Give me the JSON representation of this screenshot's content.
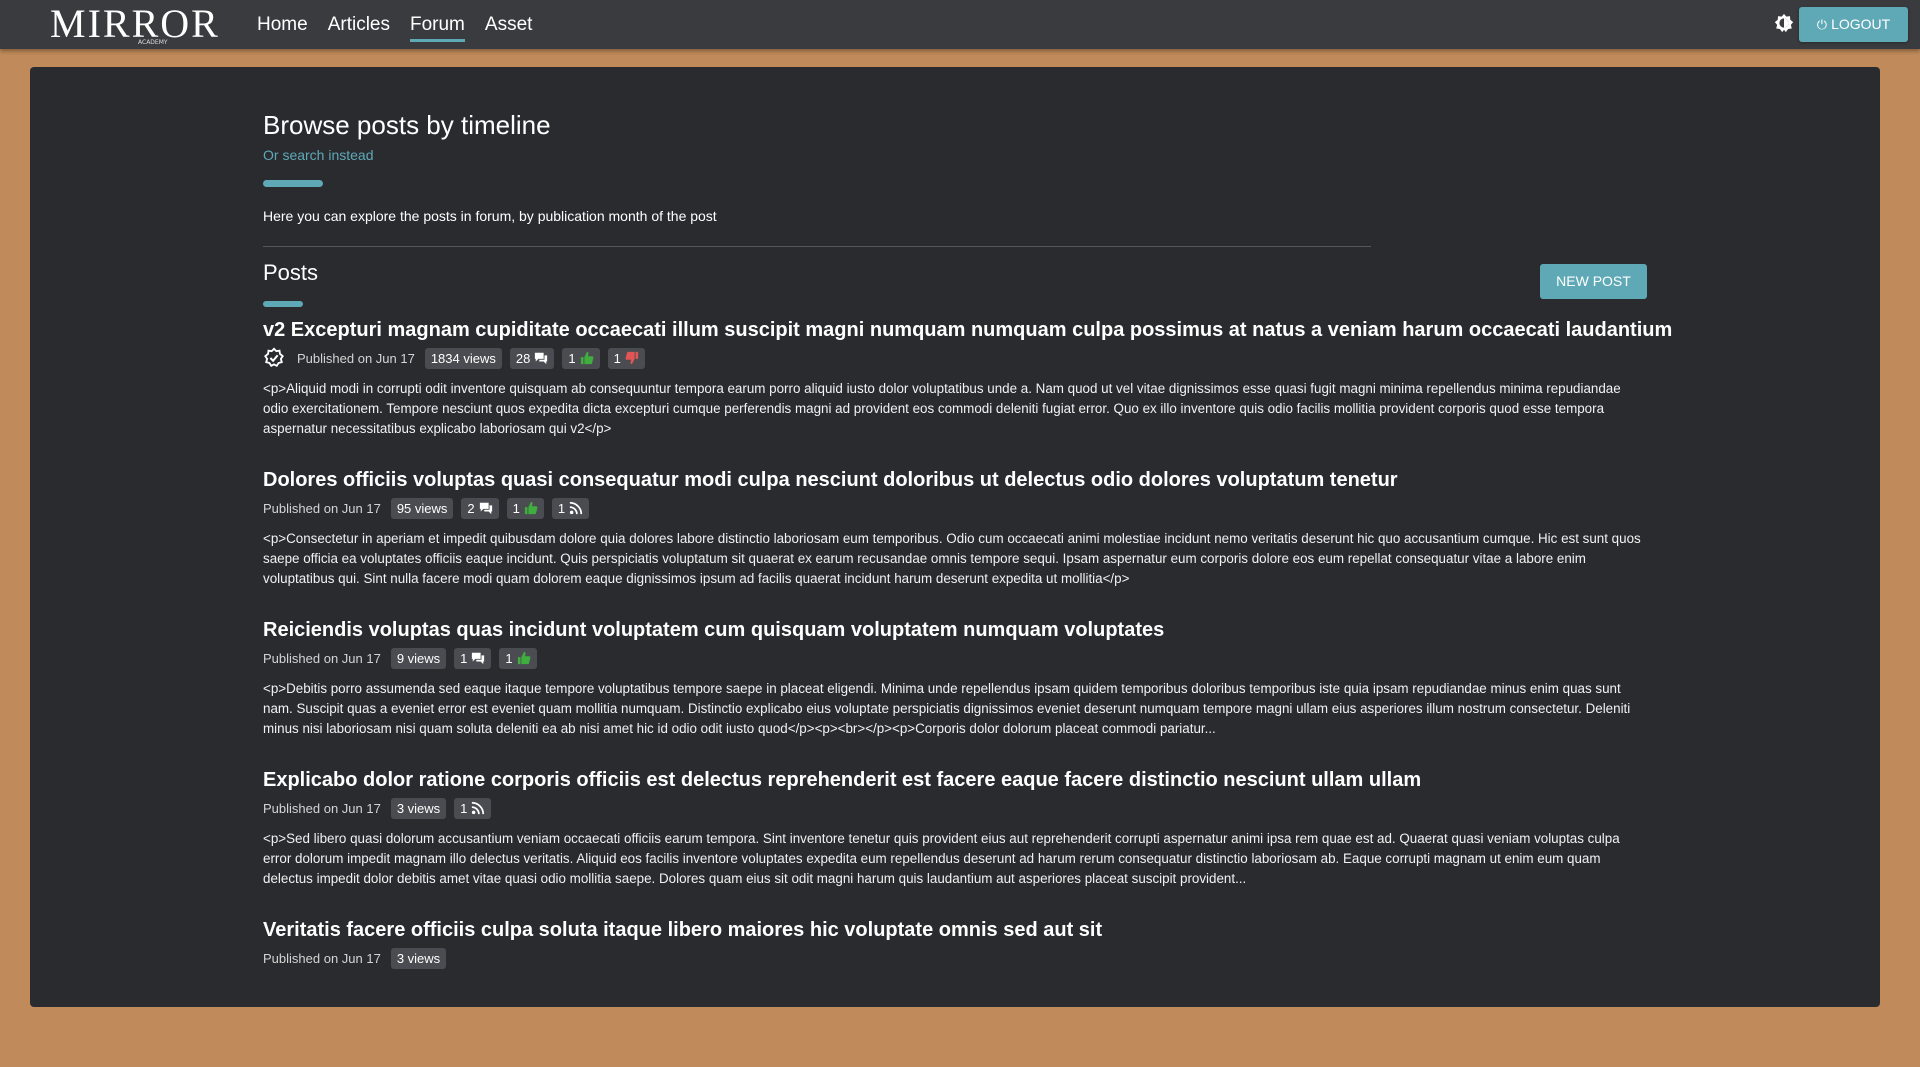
{
  "header": {
    "logo": "MIRROR",
    "logo_sub": "ACADEMY",
    "nav": [
      {
        "label": "Home",
        "active": false
      },
      {
        "label": "Articles",
        "active": false
      },
      {
        "label": "Forum",
        "active": true
      },
      {
        "label": "Asset",
        "active": false
      }
    ],
    "theme_icon": "brightness-icon",
    "logout_label": "LOGOUT",
    "accent_color": "#5fa9b7"
  },
  "page": {
    "title": "Browse posts by timeline",
    "search_link": "Or search instead",
    "intro": "Here you can explore the posts in forum, by publication month of the post",
    "posts_heading": "Posts",
    "new_post_label": "NEW POST"
  },
  "posts": [
    {
      "title": "v2 Excepturi magnam cupiditate occaecati illum suscipit magni numquam numquam culpa possimus at natus a veniam harum occaecati laudantium",
      "verified": true,
      "published": "Published on Jun 17",
      "views": "1834 views",
      "comments": "28",
      "likes": "1",
      "dislikes": "1",
      "excerpt": "<p>Aliquid modi in corrupti odit inventore quisquam ab consequuntur tempora earum porro aliquid iusto dolor voluptatibus unde a. Nam quod ut vel vitae dignissimos esse quasi fugit magni minima repellendus minima repudiandae odio exercitationem. Tempore nesciunt quos expedita dicta excepturi cumque perferendis magni ad provident eos commodi deleniti fugiat error. Quo ex illo inventore quis odio facilis mollitia provident corporis quod esse tempora aspernatur necessitatibus explicabo laboriosam qui v2</p>"
    },
    {
      "title": "Dolores officiis voluptas quasi consequatur modi culpa nesciunt doloribus ut delectus odio dolores voluptatum tenetur",
      "verified": false,
      "published": "Published on Jun 17",
      "views": "95 views",
      "comments": "2",
      "likes": "1",
      "follows": "1",
      "excerpt": "<p>Consectetur in aperiam et impedit quibusdam dolore quia dolores labore distinctio laboriosam eum temporibus. Odio cum occaecati animi molestiae incidunt nemo veritatis deserunt hic quo accusantium cumque. Hic est sunt quos saepe officia ea voluptates officiis eaque incidunt. Quis perspiciatis voluptatum sit quaerat ex earum recusandae omnis tempore sequi. Ipsam aspernatur eum corporis dolore eos eum repellat consequatur vitae a labore enim voluptatibus qui. Sint nulla facere modi quam dolorem eaque dignissimos ipsum ad facilis quaerat incidunt harum deserunt expedita ut mollitia</p>"
    },
    {
      "title": "Reiciendis voluptas quas incidunt voluptatem cum quisquam voluptatem numquam voluptates",
      "verified": false,
      "published": "Published on Jun 17",
      "views": "9 views",
      "comments": "1",
      "likes": "1",
      "excerpt": "<p>Debitis porro assumenda sed eaque itaque tempore voluptatibus tempore saepe in placeat eligendi. Minima unde repellendus ipsam quidem temporibus doloribus temporibus iste quia ipsam repudiandae minus enim quas sunt nam. Suscipit quas a eveniet error est eveniet quam mollitia numquam. Distinctio explicabo eius voluptate perspiciatis dignissimos eveniet deserunt numquam tempore magni ullam eius asperiores illum nostrum consectetur. Deleniti minus nisi laboriosam nisi quam soluta deleniti ea ab nisi amet hic id odio odit iusto quod</p><p><br></p><p>Corporis dolor dolorum placeat commodi pariatur..."
    },
    {
      "title": "Explicabo dolor ratione corporis officiis est delectus reprehenderit est facere eaque facere distinctio nesciunt ullam ullam",
      "verified": false,
      "published": "Published on Jun 17",
      "views": "3 views",
      "follows": "1",
      "excerpt": "<p>Sed libero quasi dolorum accusantium veniam occaecati officiis earum tempora. Sint inventore tenetur quis provident eius aut reprehenderit corrupti aspernatur animi ipsa rem quae est ad. Quaerat quasi veniam voluptas culpa error dolorum impedit magnam illo delectus veritatis. Aliquid eos facilis inventore voluptates expedita eum repellendus deserunt ad harum rerum consequatur distinctio laboriosam ab. Eaque corrupti magnam ut enim eum quam delectus impedit dolor debitis amet vitae quasi odio mollitia saepe. Dolores quam eius sit odit magni harum quis laudantium aut asperiores placeat suscipit provident..."
    },
    {
      "title": "Veritatis facere officiis culpa soluta itaque libero maiores hic voluptate omnis sed aut sit",
      "verified": false,
      "published": "Published on Jun 17",
      "views": "3 views",
      "excerpt": ""
    }
  ]
}
